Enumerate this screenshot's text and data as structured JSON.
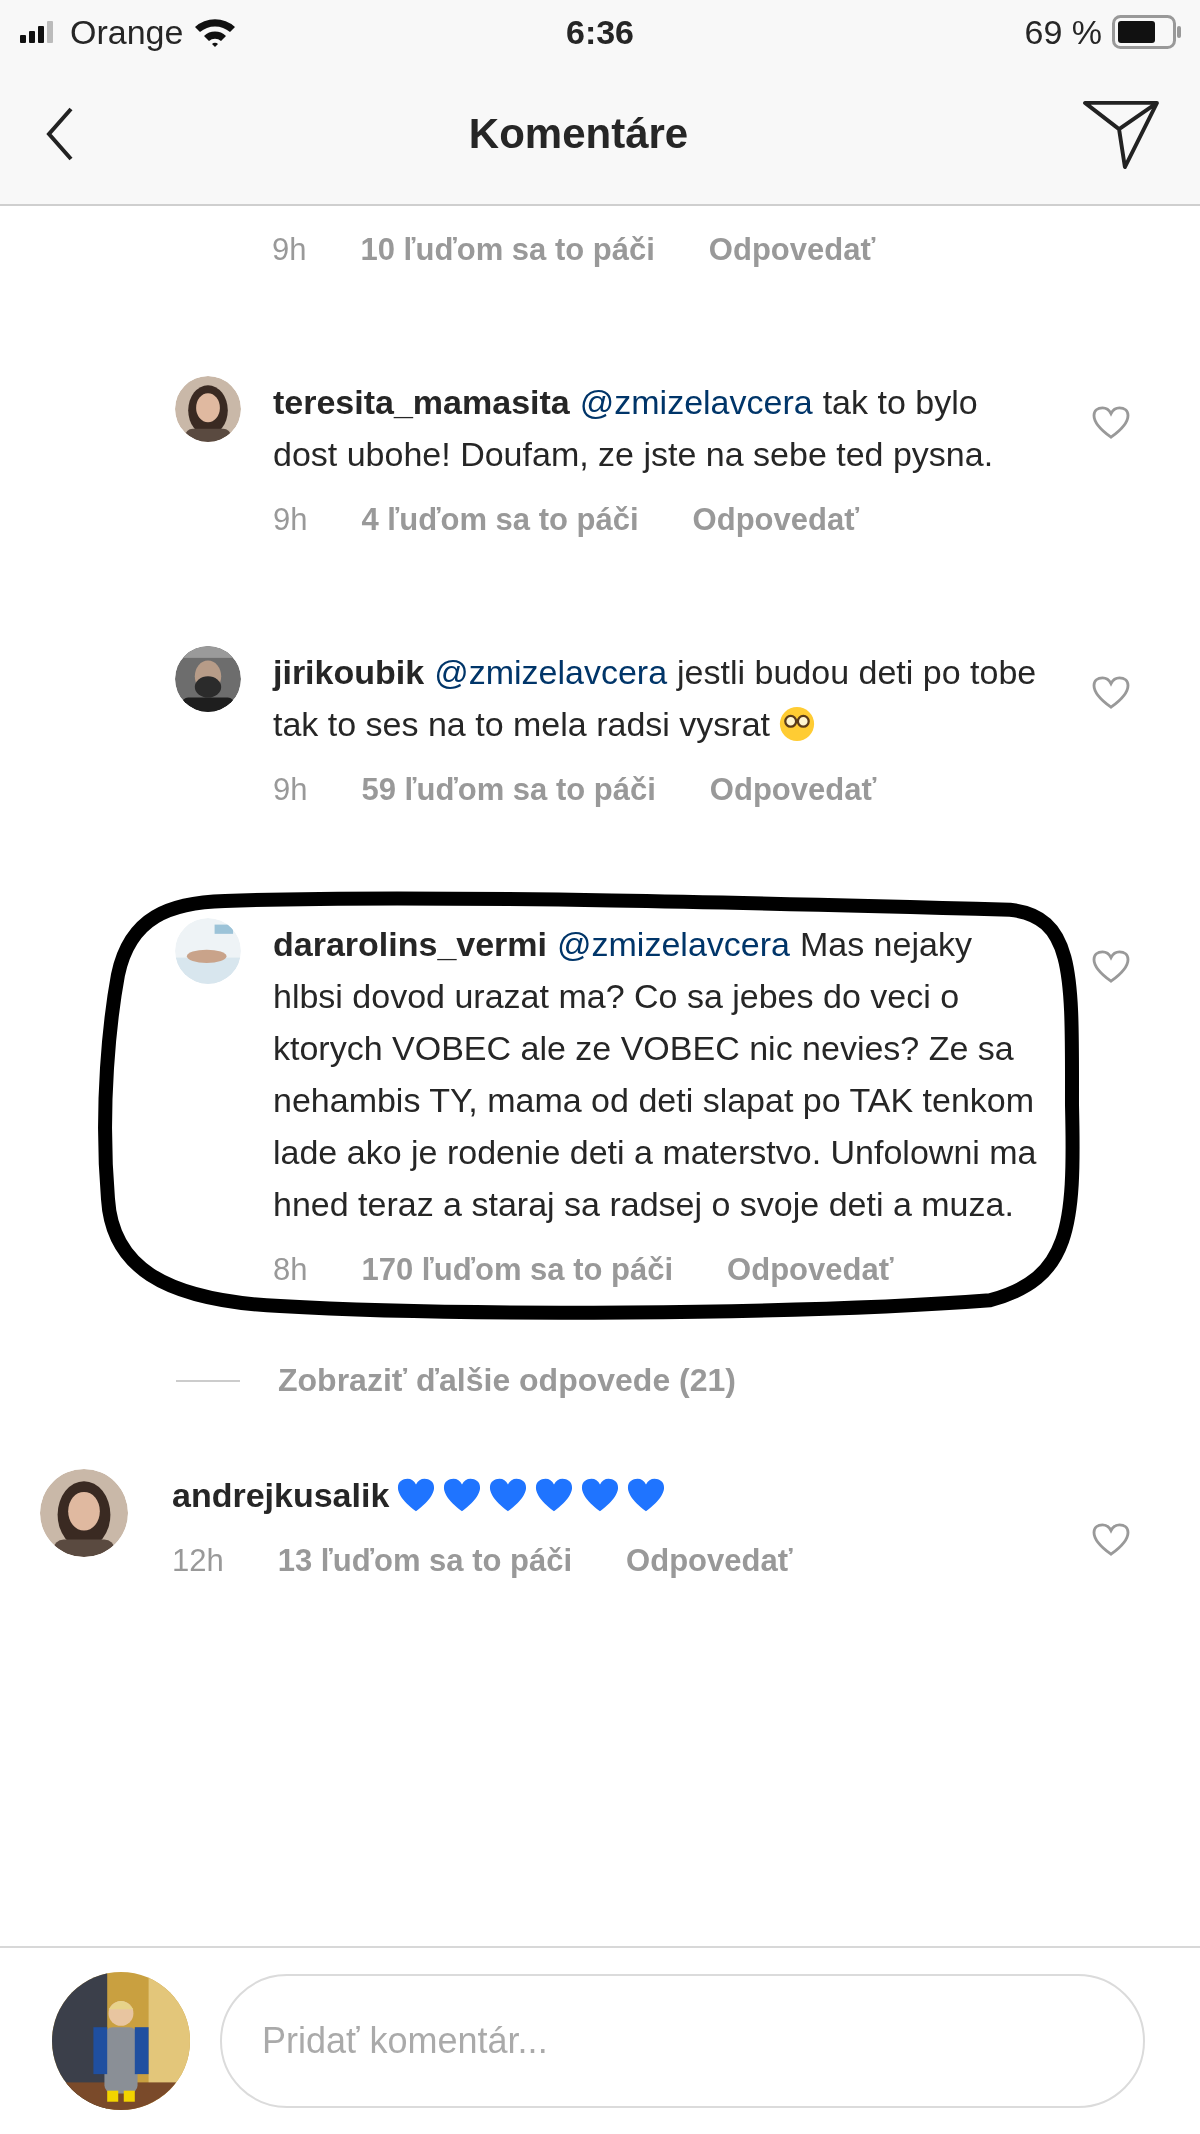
{
  "status_bar": {
    "carrier": "Orange",
    "time": "6:36",
    "battery": "69 %"
  },
  "header": {
    "title": "Komentáre"
  },
  "comments": [
    {
      "kind": "meta_only",
      "time": "9h",
      "likes": "10 ľuďom sa to páči",
      "reply": "Odpovedať"
    },
    {
      "kind": "reply",
      "username": "teresita_mamasita",
      "mention": "@zmizelavcera",
      "text": "tak to bylo dost ubohe! Doufam, ze jste na sebe ted pysna.",
      "time": "9h",
      "likes": "4 ľuďom sa to páči",
      "reply": "Odpovedať",
      "circled": false
    },
    {
      "kind": "reply",
      "username": "jirikoubik",
      "mention": "@zmizelavcera",
      "text": "jestli budou deti po tobe tak to ses na to mela radsi vysrat",
      "emojis": [
        {
          "kind": "nerd"
        }
      ],
      "time": "9h",
      "likes": "59 ľuďom sa to páči",
      "reply": "Odpovedať",
      "circled": false
    },
    {
      "kind": "reply",
      "username": "dararolins_vermi",
      "mention": "@zmizelavcera",
      "text": "Mas nejaky hlbsi dovod urazat ma? Co sa jebes do veci o ktorych VOBEC ale ze VOBEC nic nevies? Ze sa nehambis TY, mama od deti slapat po TAK tenkom lade ako je rodenie deti a materstvo. Unfolowni ma hned teraz a staraj sa radsej o svoje deti a muza.",
      "time": "8h",
      "likes": "170 ľuďom sa to páči",
      "reply": "Odpovedať",
      "circled": true
    },
    {
      "kind": "more",
      "label": "Zobraziť ďalšie odpovede (21)"
    },
    {
      "kind": "comment",
      "username": "andrejkusalik",
      "emojis": [
        {
          "kind": "heart"
        },
        {
          "kind": "heart"
        },
        {
          "kind": "heart"
        },
        {
          "kind": "heart"
        },
        {
          "kind": "heart"
        },
        {
          "kind": "heart"
        }
      ],
      "time": "12h",
      "likes": "13 ľuďom sa to páči",
      "reply": "Odpovedať",
      "circled": false
    }
  ],
  "composer": {
    "placeholder": "Pridať komentár..."
  }
}
